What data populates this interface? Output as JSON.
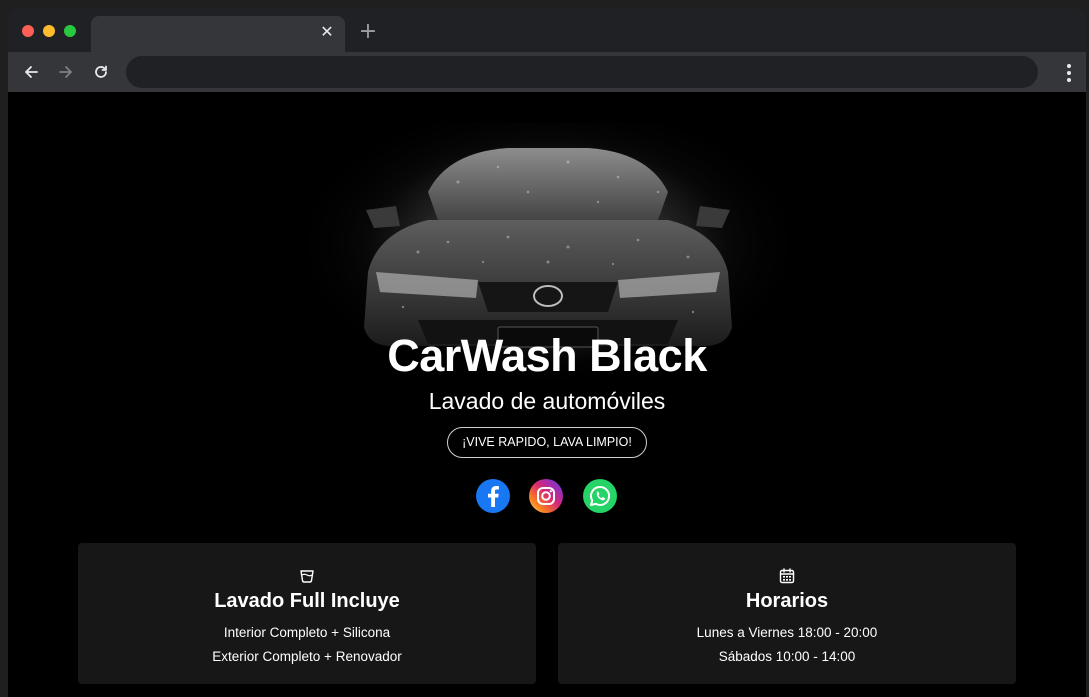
{
  "browser": {
    "tab_close": "✕",
    "new_tab": "+"
  },
  "hero": {
    "title": "CarWash Black",
    "subtitle": "Lavado de automóviles",
    "slogan": "¡VIVE RAPIDO, LAVA LIMPIO!"
  },
  "social": [
    {
      "icon": "facebook-icon",
      "color": "#1877f2"
    },
    {
      "icon": "instagram-icon",
      "color": "#d62976"
    },
    {
      "icon": "whatsapp-icon",
      "color": "#25d366"
    }
  ],
  "cards": {
    "wash": {
      "icon": "bucket-icon",
      "title": "Lavado Full Incluye",
      "lines": [
        "Interior Completo + Silicona",
        "Exterior Completo + Renovador"
      ]
    },
    "hours": {
      "icon": "calendar-icon",
      "title": "Horarios",
      "lines": [
        "Lunes a Viernes 18:00 - 20:00",
        "Sábados 10:00 - 14:00"
      ]
    }
  },
  "colors": {
    "page_background": "#000000",
    "card_background": "#171717",
    "text": "#ffffff"
  }
}
